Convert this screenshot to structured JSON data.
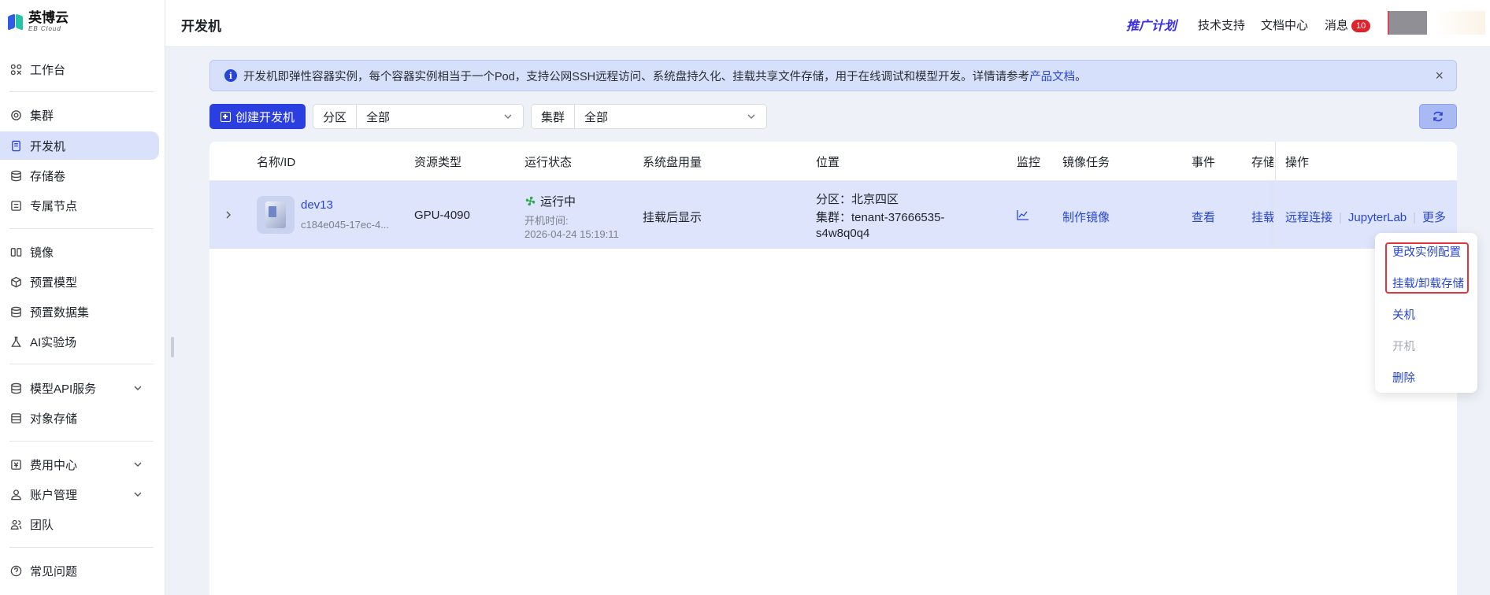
{
  "brand": {
    "name_cn": "英博云",
    "name_en": "EB Cloud"
  },
  "sidebar": {
    "items": [
      {
        "label": "工作台",
        "icon": "workbench-icon"
      },
      {
        "label": "集群",
        "icon": "cluster-icon"
      },
      {
        "label": "开发机",
        "icon": "devmachine-icon",
        "active": true
      },
      {
        "label": "存储卷",
        "icon": "database-icon"
      },
      {
        "label": "专属节点",
        "icon": "node-icon"
      },
      {
        "label": "镜像",
        "icon": "image-icon"
      },
      {
        "label": "预置模型",
        "icon": "cube-icon"
      },
      {
        "label": "预置数据集",
        "icon": "dataset-icon"
      },
      {
        "label": "AI实验场",
        "icon": "flask-icon"
      },
      {
        "label": "模型API服务",
        "icon": "api-icon",
        "expandable": true
      },
      {
        "label": "对象存储",
        "icon": "bucket-icon"
      },
      {
        "label": "费用中心",
        "icon": "yen-icon",
        "expandable": true
      },
      {
        "label": "账户管理",
        "icon": "user-icon",
        "expandable": true
      },
      {
        "label": "团队",
        "icon": "team-icon"
      },
      {
        "label": "常见问题",
        "icon": "help-icon"
      }
    ]
  },
  "header": {
    "title": "开发机",
    "promo": "推广计划",
    "links": [
      "技术支持",
      "文档中心"
    ],
    "messages_label": "消息",
    "messages_count": "10"
  },
  "banner": {
    "text": "开发机即弹性容器实例，每个容器实例相当于一个Pod，支持公网SSH远程访问、系统盘持久化、挂载共享文件存储，用于在线调试和模型开发。详情请参考 ",
    "link": "产品文档",
    "suffix": "。",
    "close": "×"
  },
  "toolbar": {
    "create_label": "创建开发机",
    "partition_label": "分区",
    "partition_value": "全部",
    "cluster_label": "集群",
    "cluster_value": "全部"
  },
  "table": {
    "headers": [
      "名称/ID",
      "资源类型",
      "运行状态",
      "系统盘用量",
      "位置",
      "监控",
      "镜像任务",
      "事件",
      "存储",
      "操作"
    ],
    "row": {
      "name": "dev13",
      "id": "c184e045-17ec-4...",
      "resource": "GPU-4090",
      "status": "运行中",
      "boot_label": "开机时间:",
      "boot_time": "2026-04-24 15:19:11",
      "disk": "挂载后显示",
      "location_partition": "分区：北京四区",
      "location_cluster_1": "集群：tenant-37666535-",
      "location_cluster_2": "s4w8q0q4",
      "mirror_task": "制作镜像",
      "event": "查看",
      "storage": "挂载",
      "ops": [
        "远程连接",
        "JupyterLab",
        "更多"
      ]
    }
  },
  "dropdown": {
    "items": [
      "更改实例配置",
      "挂载/卸载存储",
      "关机",
      "开机",
      "删除"
    ],
    "disabled": [
      "开机"
    ],
    "highlight_color": "#e5333c"
  },
  "colors": {
    "accent": "#2b3fe0",
    "link": "#2746d8",
    "active_bg": "#d9e1fb",
    "status_green": "#2fa84f",
    "badge": "#e0222b"
  }
}
